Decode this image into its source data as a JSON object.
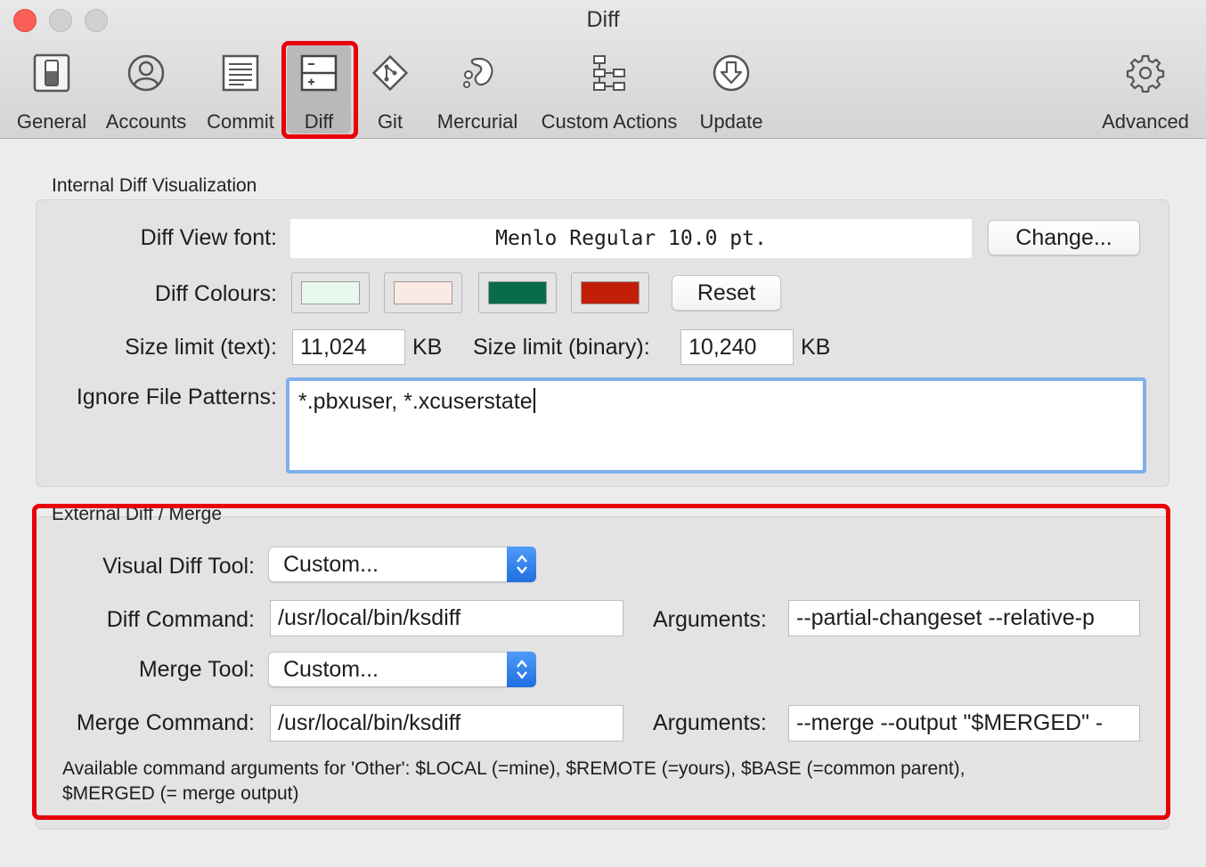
{
  "window": {
    "title": "Diff"
  },
  "toolbar": {
    "items": [
      {
        "label": "General",
        "icon": "switch-icon"
      },
      {
        "label": "Accounts",
        "icon": "person-icon"
      },
      {
        "label": "Commit",
        "icon": "document-icon"
      },
      {
        "label": "Diff",
        "icon": "diff-icon",
        "selected": true
      },
      {
        "label": "Git",
        "icon": "git-icon"
      },
      {
        "label": "Mercurial",
        "icon": "mercurial-icon"
      },
      {
        "label": "Custom Actions",
        "icon": "flow-icon"
      },
      {
        "label": "Update",
        "icon": "download-icon"
      },
      {
        "label": "Advanced",
        "icon": "gear-icon"
      }
    ]
  },
  "internal": {
    "title": "Internal Diff Visualization",
    "font_label": "Diff View font:",
    "font_value": "Menlo Regular 10.0 pt.",
    "change_button": "Change...",
    "colours_label": "Diff Colours:",
    "colours": [
      "#e8f8ef",
      "#fbe9e4",
      "#0a6a4c",
      "#c31f08"
    ],
    "reset_button": "Reset",
    "size_text_label": "Size limit (text):",
    "size_text_value": "11,024",
    "size_unit": "KB",
    "size_binary_label": "Size limit (binary):",
    "size_binary_value": "10,240",
    "ignore_label": "Ignore File Patterns:",
    "ignore_value": "*.pbxuser, *.xcuserstate"
  },
  "external": {
    "title": "External Diff / Merge",
    "visual_tool_label": "Visual Diff Tool:",
    "visual_tool_value": "Custom...",
    "diff_command_label": "Diff Command:",
    "diff_command_value": "/usr/local/bin/ksdiff",
    "arguments_label": "Arguments:",
    "diff_arguments_value": "--partial-changeset --relative-p",
    "merge_tool_label": "Merge Tool:",
    "merge_tool_value": "Custom...",
    "merge_command_label": "Merge Command:",
    "merge_command_value": "/usr/local/bin/ksdiff",
    "merge_arguments_value": "--merge --output \"$MERGED\" -",
    "note_line1": "Available command arguments for 'Other': $LOCAL (=mine), $REMOTE (=yours), $BASE (=common parent),",
    "note_line2": "$MERGED (= merge output)"
  },
  "colors": {
    "highlight": "#e8000a",
    "accent": "#1f6fe0",
    "focus_ring": "#7fb0ea"
  }
}
